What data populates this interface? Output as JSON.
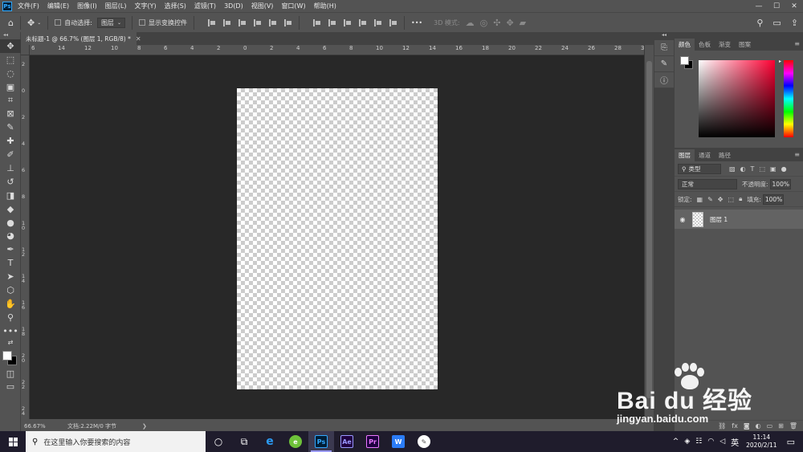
{
  "app": {
    "logo": "Ps",
    "menu": [
      "文件(F)",
      "编辑(E)",
      "图像(I)",
      "图层(L)",
      "文字(Y)",
      "选择(S)",
      "滤镜(T)",
      "3D(D)",
      "视图(V)",
      "窗口(W)",
      "帮助(H)"
    ],
    "window_controls": [
      "—",
      "☐",
      "✕"
    ]
  },
  "options": {
    "auto_select_label": "自动选择:",
    "auto_select_value": "图层",
    "show_transform_label": "显示变换控件",
    "mode_3d_label": "3D 模式:",
    "more": "•••"
  },
  "document": {
    "tab_title": "未标题-1 @ 66.7% (图层 1, RGB/8) *",
    "close": "✕"
  },
  "ruler": {
    "h_labels": [
      "6",
      "14",
      "12",
      "10",
      "8",
      "6",
      "4",
      "2",
      "0",
      "2",
      "4",
      "6",
      "8",
      "10",
      "12",
      "14",
      "16",
      "18",
      "20",
      "22",
      "24",
      "26",
      "28",
      "30"
    ],
    "v_labels": [
      "2",
      "0",
      "2",
      "4",
      "6",
      "8",
      "10",
      "12",
      "14",
      "16",
      "18",
      "20",
      "22",
      "24"
    ]
  },
  "status": {
    "zoom": "66.67%",
    "doc_info": "文档:2.22M/0 字节",
    "arrow": "❯"
  },
  "colors": {
    "foreground": "#ffffff",
    "background": "#000000",
    "canvas_bg": "#282828",
    "panel_bg": "#535353"
  },
  "color_panel": {
    "tabs": [
      "颜色",
      "色板",
      "渐变",
      "图案"
    ],
    "active_tab": "颜色"
  },
  "layers_panel": {
    "tabs": [
      "图层",
      "通道",
      "路径"
    ],
    "filter_kind": "类型",
    "blend_mode": "正常",
    "opacity_label": "不透明度:",
    "opacity_value": "100%",
    "lock_label": "锁定:",
    "fill_label": "填充:",
    "fill_value": "100%",
    "layers": [
      {
        "name": "图层 1",
        "visible": true
      }
    ]
  },
  "watermark": {
    "brand": "Bai du 经验",
    "url": "jingyan.baidu.com"
  },
  "taskbar": {
    "search_placeholder": "在这里输入你要搜索的内容",
    "apps": [
      "cortana",
      "task-view",
      "edge",
      "360",
      "photoshop",
      "after-effects",
      "premiere",
      "wps",
      "feather"
    ],
    "app_labels": {
      "ps": "Ps",
      "ae": "Ae",
      "pr": "Pr",
      "wps": "W"
    },
    "ime": "英",
    "time": "11:14",
    "date": "2020/2/11"
  }
}
